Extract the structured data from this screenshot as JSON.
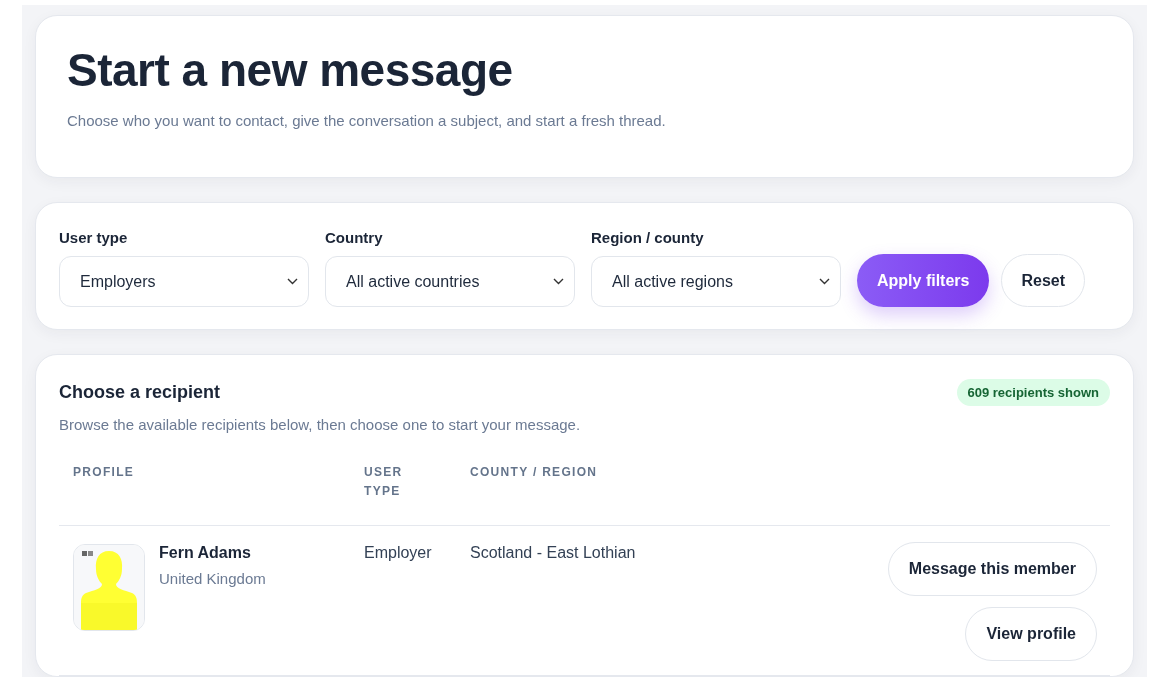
{
  "header": {
    "title": "Start a new message",
    "subtitle": "Choose who you want to contact, give the conversation a subject, and start a fresh thread."
  },
  "filters": [
    {
      "label": "User type",
      "value": "Employers"
    },
    {
      "label": "Country",
      "value": "All active countries"
    },
    {
      "label": "Region / county",
      "value": "All active regions"
    }
  ],
  "buttons": [
    {
      "label": "Apply filters",
      "kind": "primary"
    },
    {
      "label": "Reset",
      "kind": "secondary"
    }
  ],
  "recipients": {
    "title": "Choose a recipient",
    "description": "Browse the available recipients below, then choose one to start your message.",
    "count_badge": "609 recipients shown",
    "columns": [
      "PROFILE",
      "USER TYPE",
      "COUNTY / REGION"
    ],
    "rows": [
      {
        "avatar": {
          "kind": "picture"
        },
        "name": "Fern Adams",
        "country": "United Kingdom",
        "user_type": "Employer",
        "region": "Scotland - East Lothian",
        "actions": [
          "Message this member",
          "View profile"
        ]
      }
    ]
  }
}
